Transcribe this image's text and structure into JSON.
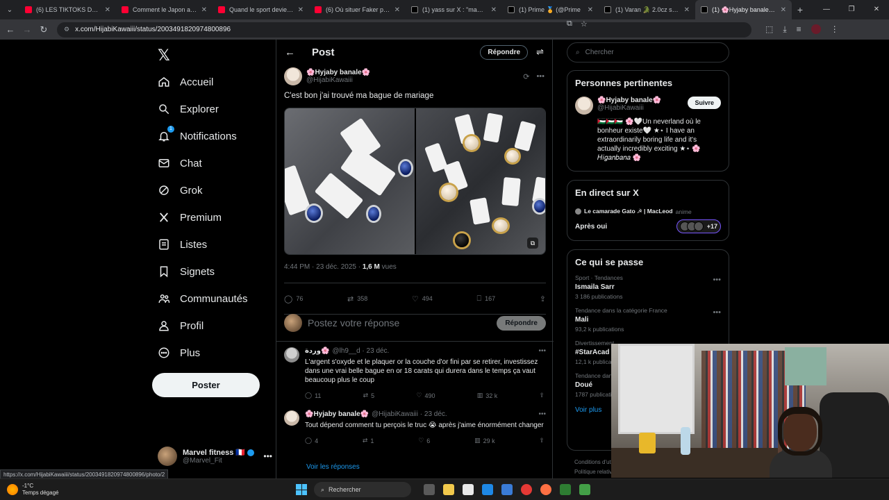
{
  "browser": {
    "tabs": [
      {
        "title": "(6) LES TIKTOKS DES POL",
        "type": "yt"
      },
      {
        "title": "Comment le Japon a inve",
        "type": "yt"
      },
      {
        "title": "Quand le sport devient TC",
        "type": "yt"
      },
      {
        "title": "(6) Où situer Faker parmi",
        "type": "yt"
      },
      {
        "title": "(1) yass sur X : \"maeva gl",
        "type": "x"
      },
      {
        "title": "(1) Prime 🏅 (@Prime",
        "type": "x"
      },
      {
        "title": "(1) Varan 🐊 2.0cz sur X",
        "type": "x"
      },
      {
        "title": "(1) 🌸Hyjaby banale🌸 s",
        "type": "x"
      }
    ],
    "url": "x.com/HijabiKawaiii/status/2003491820974800896",
    "status_url": "https://x.com/HijabiKawaiii/status/2003491820974800896/photo/2"
  },
  "nav": {
    "items": [
      {
        "label": "Accueil",
        "icon": "home-icon"
      },
      {
        "label": "Explorer",
        "icon": "search-icon"
      },
      {
        "label": "Notifications",
        "icon": "bell-icon",
        "badge": "1"
      },
      {
        "label": "Chat",
        "icon": "mail-icon"
      },
      {
        "label": "Grok",
        "icon": "grok-icon"
      },
      {
        "label": "Premium",
        "icon": "x-icon"
      },
      {
        "label": "Listes",
        "icon": "list-icon"
      },
      {
        "label": "Signets",
        "icon": "bookmark-icon"
      },
      {
        "label": "Communautés",
        "icon": "community-icon"
      },
      {
        "label": "Profil",
        "icon": "person-icon"
      },
      {
        "label": "Plus",
        "icon": "more-circle-icon"
      }
    ],
    "post_button": "Poster",
    "account": {
      "name": "Marvel fitness 🇫🇷",
      "handle": "@Marvel_Fit"
    }
  },
  "main": {
    "header_title": "Post",
    "reply_button": "Répondre",
    "tweet": {
      "display_name": "🌸Hyjaby banale🌸",
      "handle": "@HijabiKawaiii",
      "text": "C'est bon j'ai trouvé ma bague de mariage",
      "time": "4:44 PM · 23 déc. 2025 · ",
      "views": "1,6 M",
      "views_label": " vues",
      "replies": "76",
      "reposts": "358",
      "likes": "494",
      "bookmarks": "167"
    },
    "composer": {
      "placeholder": "Postez votre réponse",
      "button": "Répondre"
    },
    "replies": [
      {
        "display_name": "وردة🌸",
        "handle": "@lh9__d · 23 déc.",
        "text": "L'argent s'oxyde et le plaquer or la couche d'or fini par se retirer, investissez dans une vrai belle bague en or 18 carats qui durera dans le temps ça vaut beaucoup plus le coup",
        "replies": "11",
        "reposts": "5",
        "likes": "490",
        "views": "32 k"
      },
      {
        "display_name": "🌸Hyjaby banale🌸",
        "handle": "@HijabiKawaiii · 23 déc.",
        "text": "Tout dépend comment tu perçois le truc 😭 après j'aime énormément changer",
        "replies": "4",
        "reposts": "1",
        "likes": "6",
        "views": "29 k"
      }
    ],
    "see_replies": "Voir les réponses"
  },
  "right": {
    "search_placeholder": "Chercher",
    "relevant": {
      "title": "Personnes pertinentes",
      "name": "🌸Hyjaby banale🌸",
      "handle": "@HijabiKawaiii",
      "follow": "Suivre",
      "bio": "🇵🇸🇵🇸🇵🇸 🌸🤍Un neverland où le bonheur existe🤍 ★⋆ I have an extraordinarily boring life and it's actually incredibly exciting ★⋆ 🌸 𝐻𝑖𝑔𝑎𝑛𝑏𝑎𝑛𝑎 🌸"
    },
    "live": {
      "title": "En direct sur X",
      "host": "Le camarade Gato ☭ | MacLeod",
      "host_sub": "anime",
      "status": "Après oui",
      "count": "+17"
    },
    "trends": {
      "title": "Ce qui se passe",
      "items": [
        {
          "cat": "Sport · Tendances",
          "name": "Ismaila Sarr",
          "count": "3 186 publications"
        },
        {
          "cat": "Tendance dans la catégorie France",
          "name": "Mali",
          "count": "93,2 k publications"
        },
        {
          "cat": "Divertissement",
          "name": "#StarAcad",
          "count": "12,1 k publications"
        },
        {
          "cat": "Tendance dans",
          "name": "Doué",
          "count": "1787 publications"
        }
      ],
      "see_more": "Voir plus"
    },
    "footer": [
      "Conditions d'ut",
      "Politique relativ"
    ]
  },
  "taskbar": {
    "temp": "-1°C",
    "weather": "Temps dégagé",
    "search": "Rechercher"
  }
}
